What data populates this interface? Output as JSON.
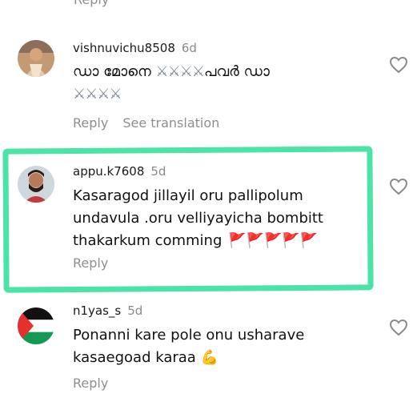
{
  "top_reply": {
    "label": "Reply"
  },
  "comments": [
    {
      "username": "vishnuvichu8508",
      "age": "6d",
      "text_line1": "ഡാ മോനെ ",
      "crossed1": "⚔⚔⚔⚔",
      "text_line1b": "പവർ ഡാ",
      "crossed2": "⚔⚔⚔⚔",
      "reply": "Reply",
      "see_translation": "See translation"
    },
    {
      "username": "appu.k7608",
      "age": "5d",
      "line1": "Kasaragod jillayil oru pallipolum",
      "line2": "undavula .oru velliyayicha bombitt",
      "line3": "thakarkum comming",
      "flags": "🚩🚩🚩🚩🚩",
      "reply": "Reply"
    },
    {
      "username": "n1yas_s",
      "age": "5d",
      "line1": "Ponanni kare pole onu usharave",
      "line2": "kasaegoad karaa",
      "emoji": "💪",
      "reply": "Reply"
    }
  ],
  "colors": {
    "highlight": "#4be3a6",
    "muted": "#8e8e8e"
  }
}
